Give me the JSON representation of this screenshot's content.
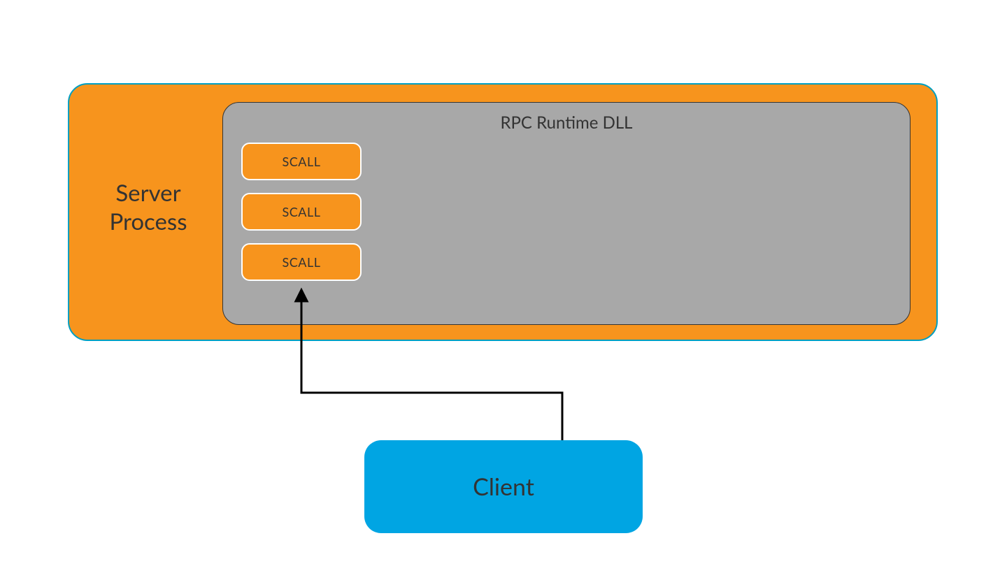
{
  "server": {
    "label": "Server\nProcess"
  },
  "rpc": {
    "label": "RPC Runtime DLL",
    "scalls": [
      "SCALL",
      "SCALL",
      "SCALL"
    ]
  },
  "client": {
    "label": "Client"
  },
  "colors": {
    "orange": "#f7941d",
    "outline_teal": "#009fc2",
    "grey": "#a8a8a8",
    "blue": "#00a5e3",
    "text": "#333333",
    "arrow": "#000000"
  }
}
